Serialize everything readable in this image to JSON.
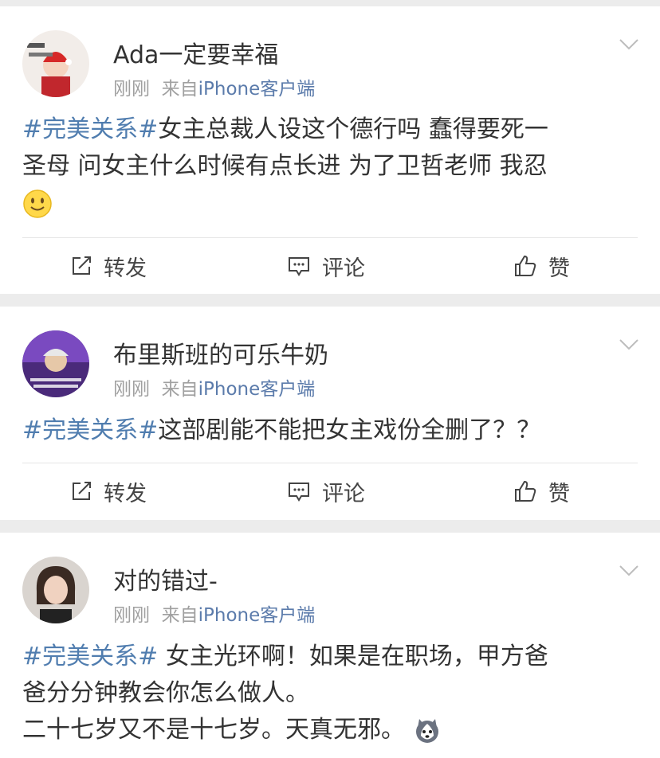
{
  "posts": [
    {
      "username": "Ada一定要幸福",
      "time": "刚刚",
      "source_prefix": "来自",
      "source": "iPhone客户端",
      "hashtag": "#完美关系#",
      "lines": [
        "女主总裁人设这个德行吗 蠢得要死一",
        "圣母 问女主什么时候有点长进 为了卫哲老师 我忍"
      ],
      "emoji": "smile-emoji"
    },
    {
      "username": "布里斯班的可乐牛奶",
      "time": "刚刚",
      "source_prefix": "来自",
      "source": "iPhone客户端",
      "hashtag": "#完美关系#",
      "lines": [
        "这部剧能不能把女主戏份全删了？？"
      ]
    },
    {
      "username": "对的错过-",
      "time": "刚刚",
      "source_prefix": "来自",
      "source": "iPhone客户端",
      "hashtag": "#完美关系#",
      "lines": [
        " 女主光环啊！如果是在职场，甲方爸",
        "爸分分钟教会你怎么做人。",
        "二十七岁又不是十七岁。天真无邪。"
      ],
      "emoji": "husky-emoji"
    }
  ],
  "actions": {
    "repost": "转发",
    "comment": "评论",
    "like": "赞"
  },
  "colors": {
    "hashtag": "#507daf",
    "meta": "#a0a0a0",
    "background": "#ececec"
  }
}
